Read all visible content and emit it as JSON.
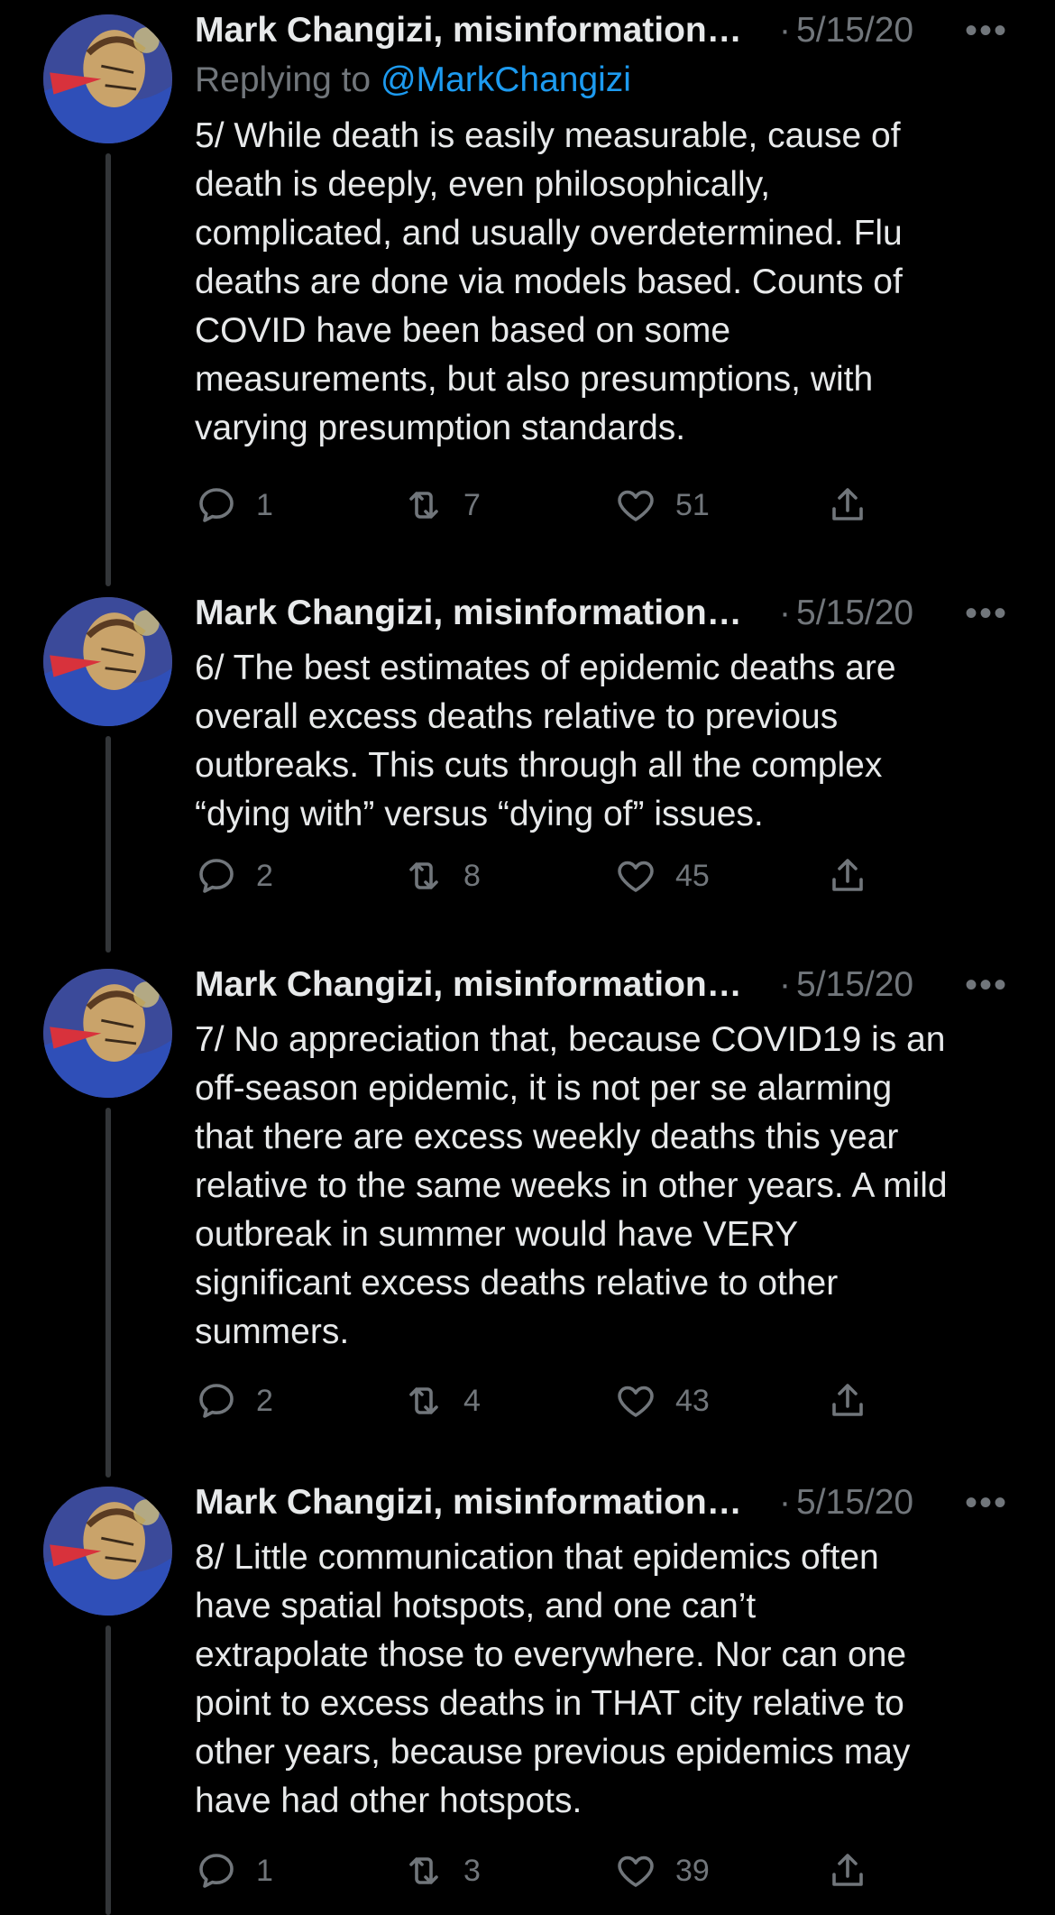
{
  "colors": {
    "background": "#000000",
    "text": "#e7e9ea",
    "secondary": "#71767b",
    "link": "#1d9bf0",
    "thread_line": "#333639"
  },
  "tweets": [
    {
      "author": "Mark Changizi, misinformation…",
      "date": "5/15/20",
      "more": "•••",
      "replying_prefix": "Replying to ",
      "replying_handle": "@MarkChangizi",
      "text": "5/ While death is easily measurable, cause of\ndeath is deeply, even philosophically,\ncomplicated, and usually overdetermined. Flu\ndeaths are done via models based. Counts of\nCOVID have been based on some\nmeasurements, but also presumptions, with\nvarying presumption standards.",
      "replies": "1",
      "retweets": "7",
      "likes": "51"
    },
    {
      "author": "Mark Changizi, misinformation…",
      "date": "5/15/20",
      "more": "•••",
      "text": "6/ The best estimates of epidemic deaths are\noverall excess deaths relative to previous\noutbreaks. This cuts through all the complex\n“dying with” versus “dying of” issues.",
      "replies": "2",
      "retweets": "8",
      "likes": "45"
    },
    {
      "author": "Mark Changizi, misinformation…",
      "date": "5/15/20",
      "more": "•••",
      "text": "7/ No appreciation that, because COVID19 is an\noff-season epidemic, it is not per se alarming\nthat there are excess weekly deaths this year\nrelative to the same weeks in other years. A mild\noutbreak in summer would have VERY\nsignificant excess deaths relative to other\nsummers.",
      "replies": "2",
      "retweets": "4",
      "likes": "43"
    },
    {
      "author": "Mark Changizi, misinformation…",
      "date": "5/15/20",
      "more": "•••",
      "text": "8/ Little communication that epidemics often\nhave spatial hotspots, and one can’t\nextrapolate those to everywhere. Nor can one\npoint to excess deaths in THAT city relative to\nother years, because previous epidemics may\nhave had other hotspots.",
      "replies": "1",
      "retweets": "3",
      "likes": "39"
    }
  ]
}
